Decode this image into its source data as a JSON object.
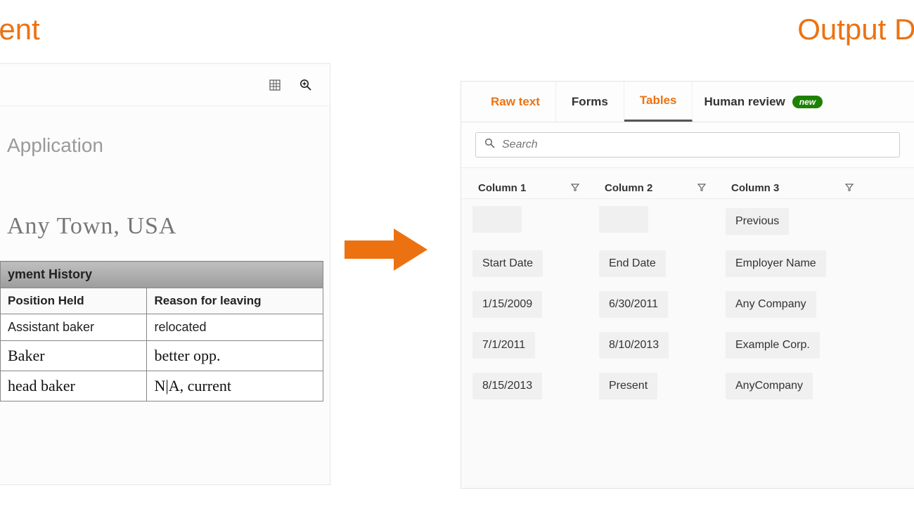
{
  "titles": {
    "left": "ument",
    "right": "Output Docu"
  },
  "left_panel": {
    "doc_heading": "Application",
    "handwritten_address": "Any Town, USA",
    "scan_table": {
      "section_header": "yment History",
      "headers": [
        "Position Held",
        "Reason for leaving"
      ],
      "rows": [
        [
          "Assistant baker",
          "relocated"
        ],
        [
          "Baker",
          "better opp."
        ],
        [
          "head baker",
          "N|A, current"
        ]
      ]
    }
  },
  "right_panel": {
    "tabs": {
      "raw": "Raw text",
      "forms": "Forms",
      "tables": "Tables",
      "human_review": "Human review",
      "badge": "new"
    },
    "search_placeholder": "Search",
    "columns": [
      "Column 1",
      "Column 2",
      "Column 3"
    ],
    "rows": [
      [
        "",
        "",
        "Previous"
      ],
      [
        "Start Date",
        "End Date",
        "Employer Name"
      ],
      [
        "1/15/2009",
        "6/30/2011",
        "Any Company"
      ],
      [
        "7/1/2011",
        "8/10/2013",
        "Example Corp."
      ],
      [
        "8/15/2013",
        "Present",
        "AnyCompany"
      ]
    ]
  }
}
